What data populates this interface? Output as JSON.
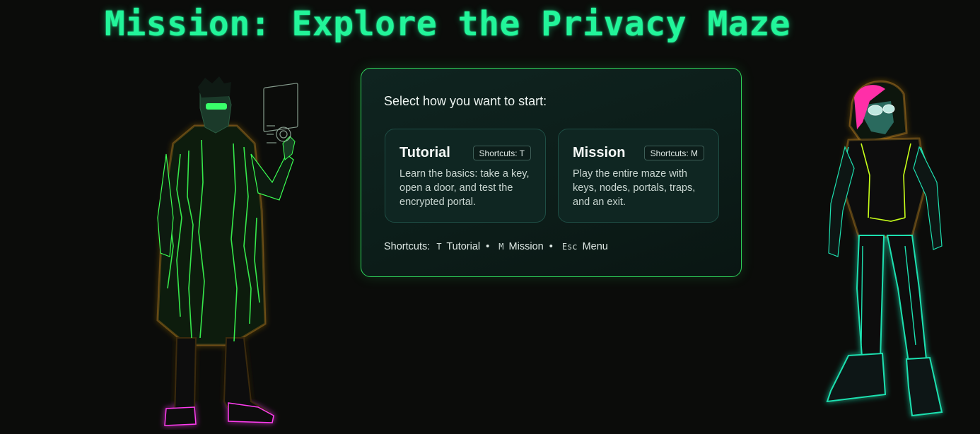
{
  "title": "Mission: Explore the Privacy Maze",
  "panel": {
    "prompt": "Select how you want to start:",
    "cards": [
      {
        "title": "Tutorial",
        "shortcut_badge": "Shortcuts: T",
        "description": "Learn the basics: take a key, open a door, and test the encrypted portal."
      },
      {
        "title": "Mission",
        "shortcut_badge": "Shortcuts: M",
        "description": "Play the entire maze with keys, nodes, portals, traps, and an exit."
      }
    ],
    "shortcuts": {
      "label": "Shortcuts:",
      "items": [
        {
          "key": "T",
          "action": "Tutorial"
        },
        {
          "key": "M",
          "action": "Mission"
        },
        {
          "key": "Esc",
          "action": "Menu"
        }
      ],
      "separator": "•"
    }
  },
  "colors": {
    "title": "#22f59a",
    "panel_border": "#2fd65a",
    "background": "#0b0c0a"
  },
  "characters": [
    "cyber-hacker-left-character",
    "cyber-hacker-right-character"
  ]
}
